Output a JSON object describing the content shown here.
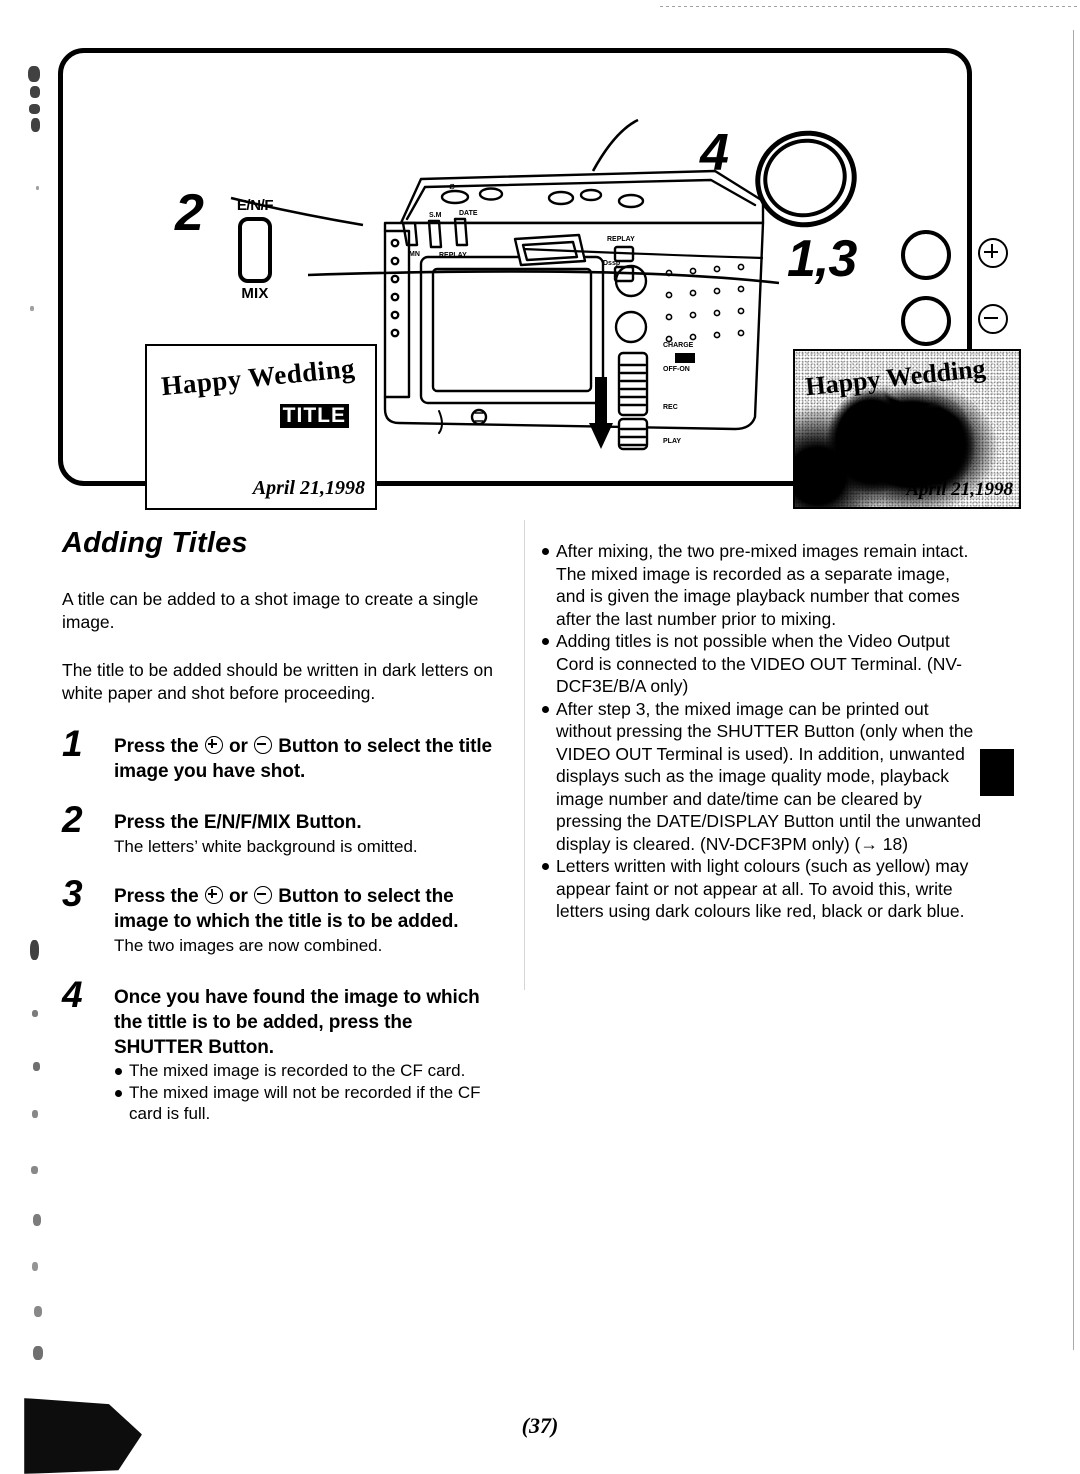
{
  "page": {
    "number": "(37)",
    "section_title": "Adding Titles"
  },
  "illustration": {
    "callouts": {
      "step2": "2",
      "step4": "4",
      "step13": "1,3"
    },
    "button_labels": {
      "enf": "E/N/F",
      "mix": "MIX"
    },
    "preview_card": {
      "title_text": "Happy Wedding",
      "title_badge": "TITLE",
      "date": "April 21,1998"
    },
    "result_photo": {
      "title_text": "Happy Wedding",
      "date": "April 21,1998"
    },
    "glyphs": {
      "plus": "plus-circle",
      "minus": "minus-circle"
    }
  },
  "left_column": {
    "intro_paragraphs": [
      "A title can be added to a shot image to create a single image.",
      "The title to be added should be written in dark letters on white paper and shot before proceeding."
    ],
    "steps": [
      {
        "number": "1",
        "head_before": "Press the",
        "head_mid": "or",
        "head_after": "Button to select the title image you have shot.",
        "sub": "",
        "bullets": []
      },
      {
        "number": "2",
        "head_plain": "Press the E/N/F/MIX Button.",
        "sub": "The letters’ white background is omitted.",
        "bullets": []
      },
      {
        "number": "3",
        "head_before": "Press the",
        "head_mid": "or",
        "head_after": "Button to select the image to which the title is to be added.",
        "sub": "The two images are now combined.",
        "bullets": []
      },
      {
        "number": "4",
        "head_plain": "Once you have found the image to which the tittle is to be added, press the SHUTTER Button.",
        "sub": "",
        "bullets": [
          "The mixed image is recorded to the CF card.",
          "The mixed image will not be recorded if the CF card is full."
        ]
      }
    ]
  },
  "right_column": {
    "notes": [
      "After mixing, the two pre-mixed images remain intact. The mixed image is recorded as a separate image, and is given the image playback number that comes after the last number prior to mixing.",
      "Adding titles is not possible when the Video Output Cord is connected to the VIDEO OUT Terminal. (NV-DCF3E/B/A only)",
      "After step 3, the mixed image can be printed out without pressing the SHUTTER Button (only when the VIDEO OUT Terminal is used). In addition, unwanted displays such as the image quality mode, playback image number and date/time can be cleared by pressing the DATE/DISPLAY Button until the unwanted display is cleared. (NV-DCF3PM only) (→ 18)",
      "Letters written with light colours (such as yellow) may appear faint or not appear at all. To avoid this, write letters using dark colours like red, black or dark blue."
    ]
  },
  "colors": {
    "ink": "#000000",
    "paper": "#ffffff"
  }
}
